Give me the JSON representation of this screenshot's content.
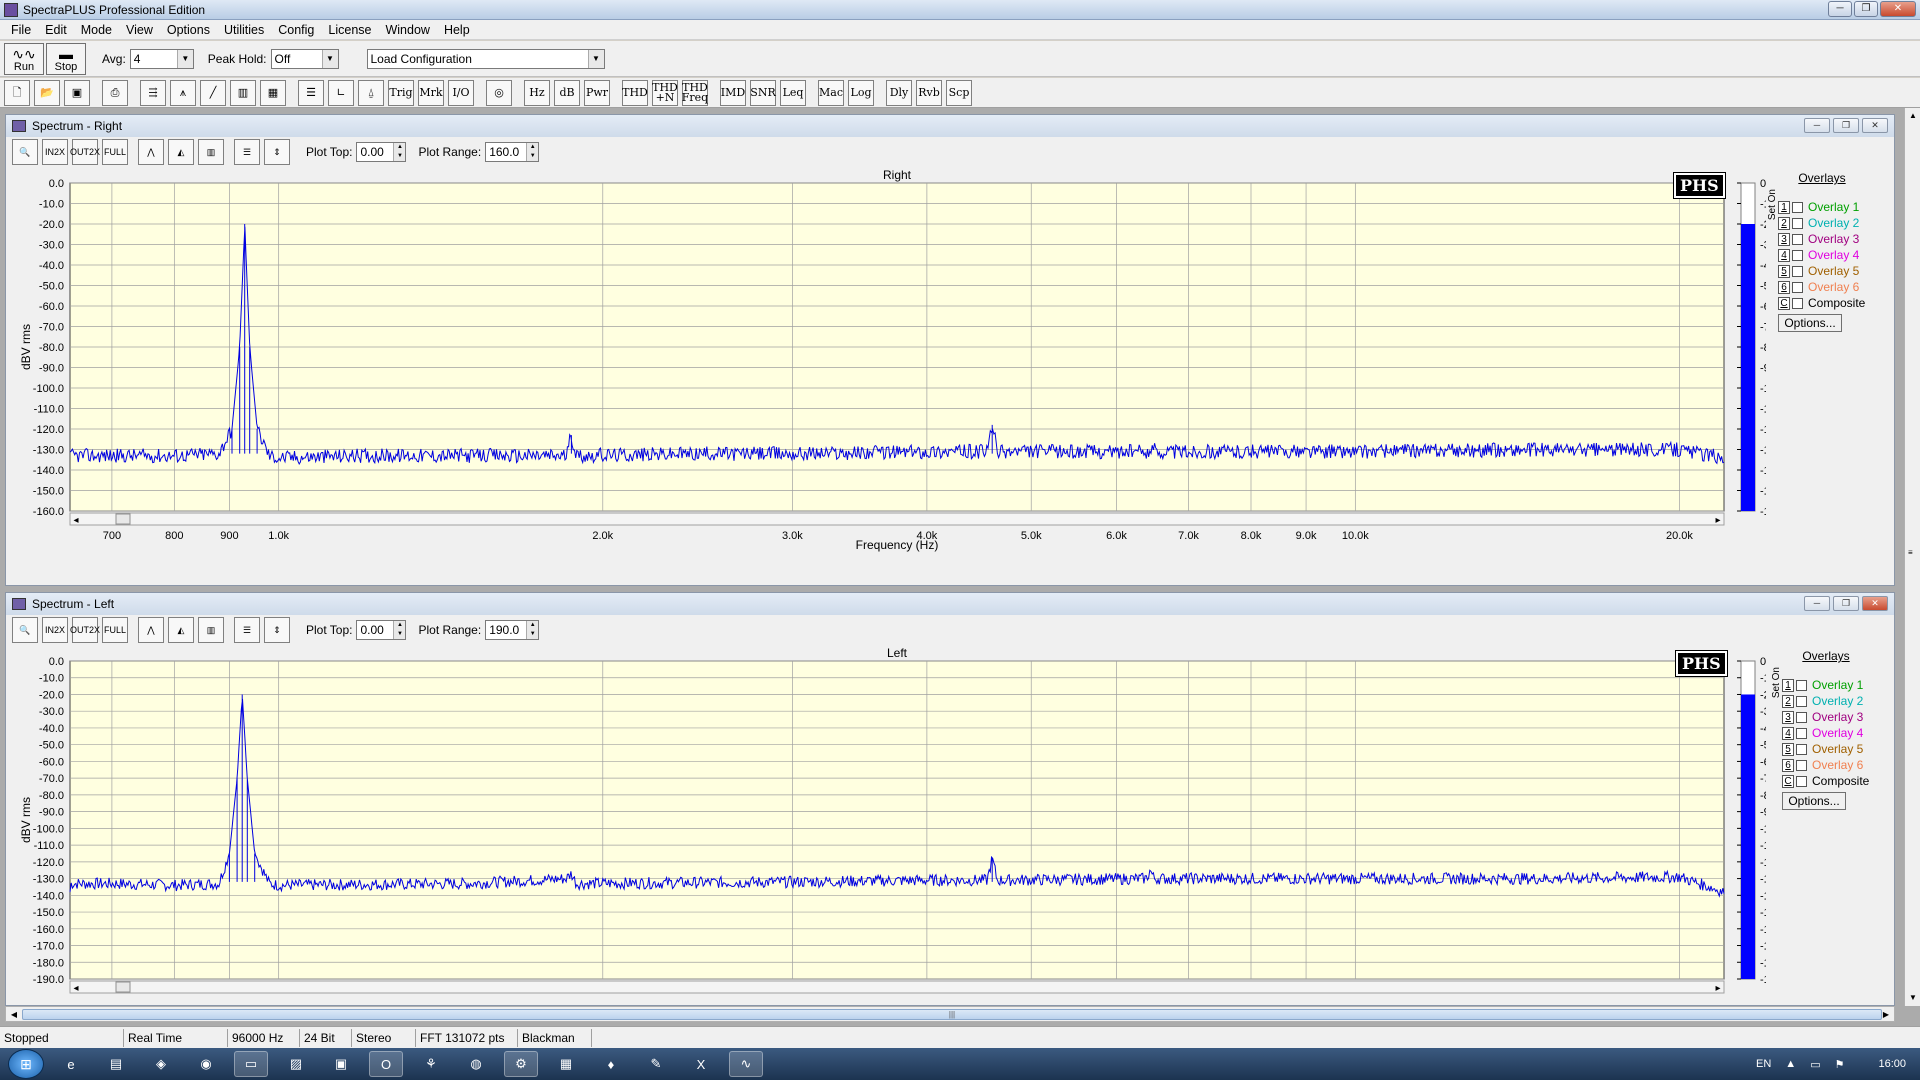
{
  "window": {
    "title": "SpectraPLUS Professional Edition"
  },
  "menu": [
    "File",
    "Edit",
    "Mode",
    "View",
    "Options",
    "Utilities",
    "Config",
    "License",
    "Window",
    "Help"
  ],
  "toolbar1": {
    "run_label": "Run",
    "stop_label": "Stop",
    "avg_label": "Avg:",
    "avg_value": "4",
    "peakhold_label": "Peak Hold:",
    "peakhold_value": "Off",
    "config_value": "Load Configuration"
  },
  "toolbar2": [
    "new-doc",
    "open-folder",
    "save",
    "print",
    "overlay-arrows",
    "spectrum-fft",
    "line-plot",
    "spectrogram",
    "3d-surface",
    "table-view",
    "axis-view",
    "phase-view",
    "Trig",
    "Mrk",
    "I/O",
    "signal-gen",
    "Hz",
    "dB",
    "Pwr",
    "THD",
    "THD +N",
    "THD Freq",
    "IMD",
    "SNR",
    "Leq",
    "Mac",
    "Log",
    "Dly",
    "Rvb",
    "Scp"
  ],
  "windows": [
    {
      "title": "Spectrum - Right",
      "plot_top_label": "Plot Top:",
      "plot_top": "0.00",
      "plot_range_label": "Plot Range:",
      "plot_range": "160.0",
      "plot_title": "Right",
      "ylabel": "dBV rms",
      "xlabel": "Frequency (Hz)",
      "y_ticks": [
        "0.0",
        "-10.0",
        "-20.0",
        "-30.0",
        "-40.0",
        "-50.0",
        "-60.0",
        "-70.0",
        "-80.0",
        "-90.0",
        "-100.0",
        "-110.0",
        "-120.0",
        "-130.0",
        "-140.0",
        "-150.0",
        "-160.0"
      ],
      "x_ticks": [
        "700",
        "800",
        "900",
        "1.0k",
        "2.0k",
        "3.0k",
        "4.0k",
        "5.0k",
        "6.0k",
        "7.0k",
        "8.0k",
        "9.0k",
        "10.0k",
        "20.0k"
      ],
      "level_bar_top": -20,
      "logo": "PHS"
    },
    {
      "title": "Spectrum - Left",
      "plot_top_label": "Plot Top:",
      "plot_top": "0.00",
      "plot_range_label": "Plot Range:",
      "plot_range": "190.0",
      "plot_title": "Left",
      "ylabel": "dBV rms",
      "y_ticks": [
        "0.0",
        "-10.0",
        "-20.0",
        "-30.0",
        "-40.0",
        "-50.0",
        "-60.0",
        "-70.0",
        "-80.0",
        "-90.0",
        "-100.0",
        "-110.0",
        "-120.0",
        "-130.0",
        "-140.0",
        "-150.0",
        "-160.0",
        "-170.0",
        "-180.0",
        "-190.0"
      ],
      "level_bar_top": -20,
      "logo": "PHS"
    }
  ],
  "overlays": {
    "header": "Overlays",
    "set_on_label": "Set On",
    "items": [
      {
        "num": "1",
        "name": "Overlay 1",
        "color": "#00a000"
      },
      {
        "num": "2",
        "name": "Overlay 2",
        "color": "#00b0b0"
      },
      {
        "num": "3",
        "name": "Overlay 3",
        "color": "#a00080"
      },
      {
        "num": "4",
        "name": "Overlay 4",
        "color": "#e000e0"
      },
      {
        "num": "5",
        "name": "Overlay 5",
        "color": "#a06000"
      },
      {
        "num": "6",
        "name": "Overlay 6",
        "color": "#f08050"
      },
      {
        "num": "C",
        "name": "Composite",
        "color": "#000000"
      }
    ],
    "options_label": "Options..."
  },
  "chart_data": [
    {
      "type": "line",
      "title": "Right",
      "xlabel": "Frequency (Hz)",
      "ylabel": "dBV rms",
      "xscale": "log",
      "xlim": [
        640,
        22000
      ],
      "ylim": [
        -160,
        0
      ],
      "grid": true,
      "series": [
        {
          "points": [
            [
              640,
              -133
            ],
            [
              700,
              -133
            ],
            [
              800,
              -133
            ],
            [
              880,
              -132
            ],
            [
              905,
              -120
            ],
            [
              920,
              -80
            ],
            [
              930,
              -20
            ],
            [
              940,
              -80
            ],
            [
              955,
              -120
            ],
            [
              980,
              -133
            ],
            [
              1000,
              -134
            ],
            [
              1200,
              -133
            ],
            [
              1500,
              -133
            ],
            [
              1850,
              -133
            ],
            [
              1870,
              -123
            ],
            [
              1890,
              -133
            ],
            [
              2500,
              -132
            ],
            [
              3000,
              -132
            ],
            [
              4000,
              -131
            ],
            [
              4550,
              -131
            ],
            [
              4600,
              -118
            ],
            [
              4650,
              -131
            ],
            [
              6000,
              -131
            ],
            [
              6500,
              -131
            ],
            [
              6520,
              -126
            ],
            [
              6540,
              -131
            ],
            [
              8000,
              -131
            ],
            [
              10000,
              -131
            ],
            [
              15000,
              -130
            ],
            [
              20000,
              -130
            ],
            [
              22000,
              -134
            ]
          ]
        }
      ],
      "color": "#0000e0"
    },
    {
      "type": "line",
      "title": "Left",
      "ylabel": "dBV rms",
      "xscale": "log",
      "xlim": [
        640,
        22000
      ],
      "ylim": [
        -190,
        0
      ],
      "grid": true,
      "series": [
        {
          "points": [
            [
              640,
              -133
            ],
            [
              700,
              -133
            ],
            [
              800,
              -134
            ],
            [
              880,
              -133
            ],
            [
              900,
              -115
            ],
            [
              915,
              -70
            ],
            [
              925,
              -20
            ],
            [
              935,
              -70
            ],
            [
              950,
              -115
            ],
            [
              980,
              -133
            ],
            [
              1000,
              -134
            ],
            [
              1500,
              -133
            ],
            [
              1850,
              -130
            ],
            [
              1870,
              -127
            ],
            [
              1890,
              -133
            ],
            [
              3000,
              -132
            ],
            [
              4000,
              -131
            ],
            [
              4550,
              -131
            ],
            [
              4600,
              -118
            ],
            [
              4650,
              -131
            ],
            [
              6400,
              -130
            ],
            [
              6450,
              -125
            ],
            [
              6500,
              -130
            ],
            [
              10000,
              -130
            ],
            [
              15000,
              -130
            ],
            [
              20000,
              -129
            ],
            [
              22000,
              -138
            ]
          ]
        }
      ],
      "color": "#0000e0"
    }
  ],
  "status": [
    "Stopped",
    "Real Time",
    "96000 Hz",
    "24 Bit",
    "Stereo",
    "FFT 131072 pts",
    "Blackman"
  ],
  "taskbar": {
    "clock": "16:00",
    "lang": "EN"
  }
}
